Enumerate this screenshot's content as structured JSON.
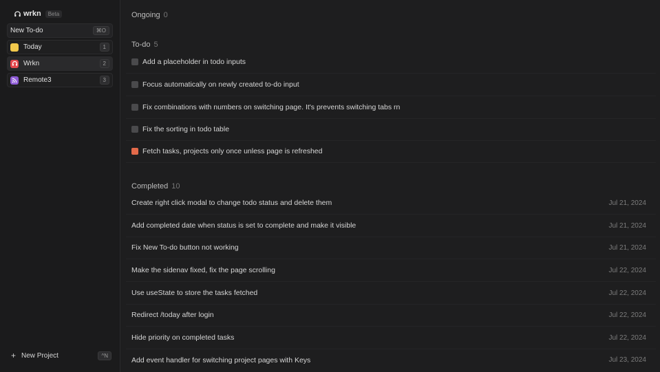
{
  "app": {
    "name": "wrkn",
    "badge": "Beta"
  },
  "sidebar": {
    "new_todo": {
      "label": "New To-do",
      "shortcut": "⌘O"
    },
    "items": [
      {
        "label": "Today",
        "count": "1",
        "icon": "today-icon",
        "color": "#f2c94c"
      },
      {
        "label": "Wrkn",
        "count": "2",
        "icon": "headphones-icon",
        "color": "#e5484d"
      },
      {
        "label": "Remote3",
        "count": "3",
        "icon": "rss-icon",
        "color": "#8e5bd6"
      }
    ],
    "new_project": {
      "label": "New Project",
      "shortcut": "^N"
    }
  },
  "sections": {
    "ongoing": {
      "label": "Ongoing",
      "count": "0"
    },
    "todo": {
      "label": "To-do",
      "count": "5",
      "items": [
        {
          "text": "Add a placeholder in todo inputs",
          "priority": "normal"
        },
        {
          "text": "Focus automatically on newly created to-do input",
          "priority": "normal"
        },
        {
          "text": "Fix combinations with numbers on switching page. It's prevents switching tabs rn",
          "priority": "normal"
        },
        {
          "text": "Fix the sorting in todo table",
          "priority": "normal"
        },
        {
          "text": "Fetch tasks, projects only once unless page is refreshed",
          "priority": "high"
        }
      ]
    },
    "completed": {
      "label": "Completed",
      "count": "10",
      "items": [
        {
          "text": "Create right click modal to change todo status and delete them",
          "date": "Jul 21, 2024"
        },
        {
          "text": "Add completed date when status is set to complete and make it visible",
          "date": "Jul 21, 2024"
        },
        {
          "text": "Fix New To-do button not working",
          "date": "Jul 21, 2024"
        },
        {
          "text": "Make the sidenav fixed, fix the page scrolling",
          "date": "Jul 22, 2024"
        },
        {
          "text": "Use useState to store the tasks fetched",
          "date": "Jul 22, 2024"
        },
        {
          "text": "Redirect /today after login",
          "date": "Jul 22, 2024"
        },
        {
          "text": "Hide priority on completed tasks",
          "date": "Jul 22, 2024"
        },
        {
          "text": "Add event handler for switching project pages with Keys",
          "date": "Jul 23, 2024"
        }
      ]
    }
  }
}
